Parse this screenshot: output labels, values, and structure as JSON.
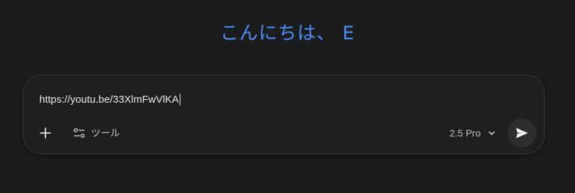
{
  "greeting": "こんにちは、 E",
  "composer": {
    "input_value": "https://youtu.be/33XlmFwVlKA",
    "tools_label": "ツール",
    "model_label": "2.5 Pro"
  },
  "icons": {
    "add": "plus-icon",
    "tools": "tune-icon",
    "model_dropdown": "chevron-down-icon",
    "send": "send-icon"
  },
  "colors": {
    "background": "#1b1c1d",
    "greeting": "#4c8df6",
    "composer_bg": "#1e1f20",
    "composer_border": "#3c3d40",
    "text": "#e8eaed",
    "muted_text": "#c4c7c5",
    "send_bg": "#2d2e30"
  }
}
